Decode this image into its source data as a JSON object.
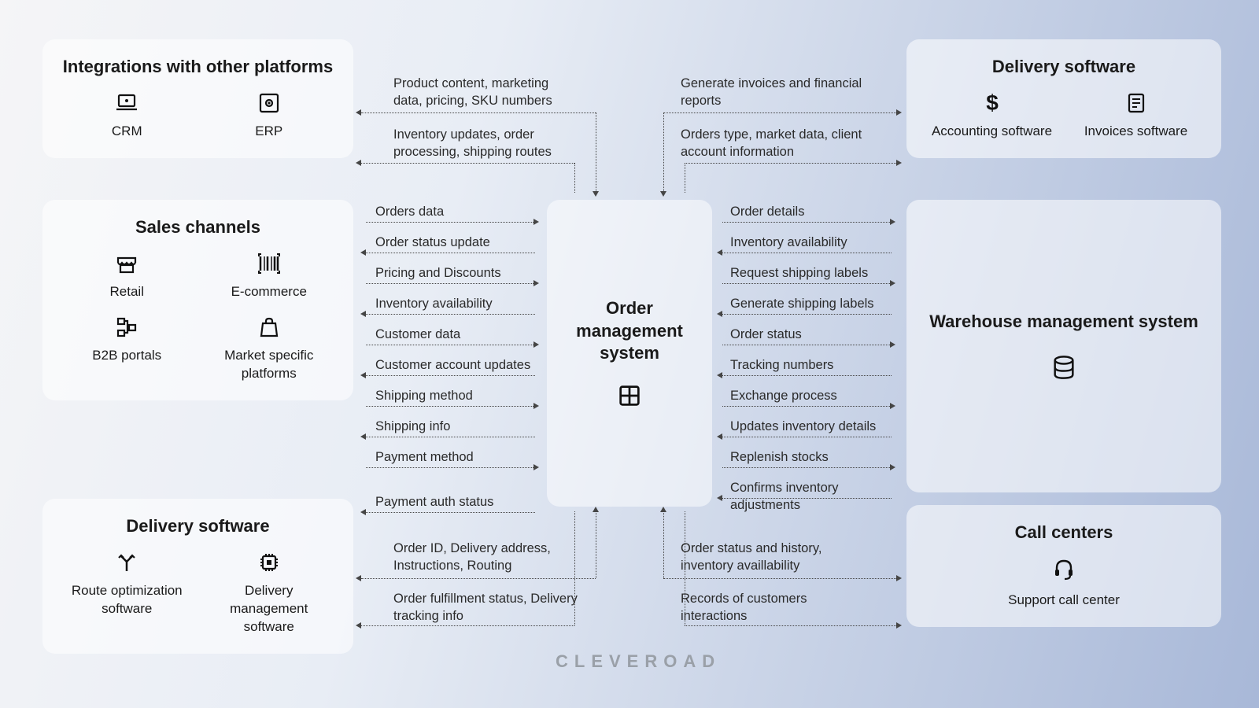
{
  "brand": "CLEVEROAD",
  "center": {
    "title": "Order management system"
  },
  "left": {
    "integrations": {
      "title": "Integrations with other platforms",
      "items": [
        {
          "label": "CRM",
          "icon": "laptop-icon"
        },
        {
          "label": "ERP",
          "icon": "gear-box-icon"
        }
      ]
    },
    "sales": {
      "title": "Sales channels",
      "items": [
        {
          "label": "Retail",
          "icon": "storefront-icon"
        },
        {
          "label": "E-commerce",
          "icon": "barcode-icon"
        },
        {
          "label": "B2B portals",
          "icon": "sitemap-icon"
        },
        {
          "label": "Market specific platforms",
          "icon": "shopping-bag-icon"
        }
      ]
    },
    "delivery": {
      "title": "Delivery software",
      "items": [
        {
          "label": "Route optimization software",
          "icon": "route-split-icon"
        },
        {
          "label": "Delivery management software",
          "icon": "chip-icon"
        }
      ]
    }
  },
  "right": {
    "delivery": {
      "title": "Delivery software",
      "items": [
        {
          "label": "Accounting software",
          "icon": "dollar-icon"
        },
        {
          "label": "Invoices software",
          "icon": "document-icon"
        }
      ]
    },
    "warehouse": {
      "title": "Warehouse management system",
      "icon": "database-icon"
    },
    "callcenters": {
      "title": "Call centers",
      "item": {
        "label": "Support call center",
        "icon": "headset-icon"
      }
    }
  },
  "flows": {
    "top_left_out": "Product content, marketing data, pricing, SKU numbers",
    "top_left_in": "Inventory updates, order processing, shipping routes",
    "top_right_out": "Generate invoices and financial reports",
    "top_right_in": "Orders type, market data, client account information",
    "left_list": [
      {
        "text": "Orders data",
        "dir": "right"
      },
      {
        "text": "Order status update",
        "dir": "left"
      },
      {
        "text": "Pricing and Discounts",
        "dir": "right"
      },
      {
        "text": "Inventory availability",
        "dir": "left"
      },
      {
        "text": "Customer data",
        "dir": "right"
      },
      {
        "text": "Customer account updates",
        "dir": "left"
      },
      {
        "text": "Shipping method",
        "dir": "right"
      },
      {
        "text": "Shipping info",
        "dir": "left"
      },
      {
        "text": "Payment method",
        "dir": "right"
      },
      {
        "text": "Payment auth status",
        "dir": "left"
      }
    ],
    "right_list": [
      {
        "text": "Order details",
        "dir": "right"
      },
      {
        "text": "Inventory availability",
        "dir": "left"
      },
      {
        "text": "Request shipping labels",
        "dir": "right"
      },
      {
        "text": "Generate shipping labels",
        "dir": "left"
      },
      {
        "text": "Order status",
        "dir": "right"
      },
      {
        "text": "Tracking numbers",
        "dir": "left"
      },
      {
        "text": "Exchange process",
        "dir": "right"
      },
      {
        "text": "Updates inventory details",
        "dir": "left"
      },
      {
        "text": "Replenish stocks",
        "dir": "right"
      },
      {
        "text": "Confirms inventory adjustments",
        "dir": "left"
      }
    ],
    "bottom_left_out": "Order ID, Delivery address, Instructions, Routing",
    "bottom_left_in": "Order fulfillment status, Delivery tracking info",
    "bottom_right_out": "Order status and history, inventory availlability",
    "bottom_right_in": "Records of customers interactions"
  }
}
